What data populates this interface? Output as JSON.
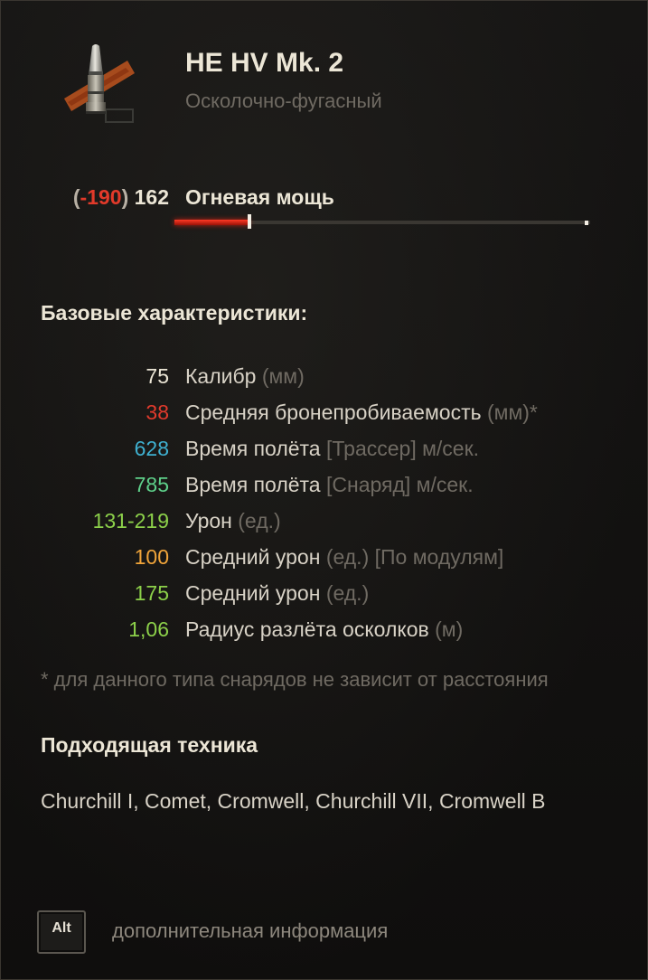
{
  "shell": {
    "name": "HE HV Mk. 2",
    "type": "Осколочно-фугасный",
    "icon": "he-shell-icon"
  },
  "firepower": {
    "delta_open": "(",
    "delta": "-190",
    "delta_close": ")",
    "value": "162",
    "label": "Огневая мощь",
    "bar_fraction": 0.18
  },
  "base_stats_title": "Базовые характеристики:",
  "stats": [
    {
      "value": "75",
      "label": "Калибр",
      "unit": "(мм)",
      "color": "#ece6d6"
    },
    {
      "value": "38",
      "label": "Средняя бронепробиваемость",
      "unit": "(мм)*",
      "color": "#e03a2c"
    },
    {
      "value": "628",
      "label": "Время полёта",
      "unit": "[Трассер] м/сек.",
      "color": "#3fb0d0"
    },
    {
      "value": "785",
      "label": "Время полёта",
      "unit": "[Снаряд] м/сек.",
      "color": "#5ed08a"
    },
    {
      "value": "131-219",
      "label": "Урон",
      "unit": "(ед.)",
      "color": "#8cd04a"
    },
    {
      "value": "100",
      "label": "Средний урон",
      "unit": "(ед.) [По модулям]",
      "color": "#f0a43a"
    },
    {
      "value": "175",
      "label": "Средний урон",
      "unit": "(ед.)",
      "color": "#8cd04a"
    },
    {
      "value": "1,06",
      "label": "Радиус разлёта осколков",
      "unit": "(м)",
      "color": "#8cd04a"
    }
  ],
  "footnote": "* для данного типа снарядов не зависит от расстояния",
  "vehicles_title": "Подходящая техника",
  "vehicles": "Churchill I, Comet, Cromwell, Churchill VII, Cromwell B",
  "alt_key": "Alt",
  "alt_hint": "дополнительная информация",
  "colors": {
    "accent_red": "#e23a2a",
    "text_primary": "#ece6d6",
    "text_muted": "#6f6a62"
  }
}
